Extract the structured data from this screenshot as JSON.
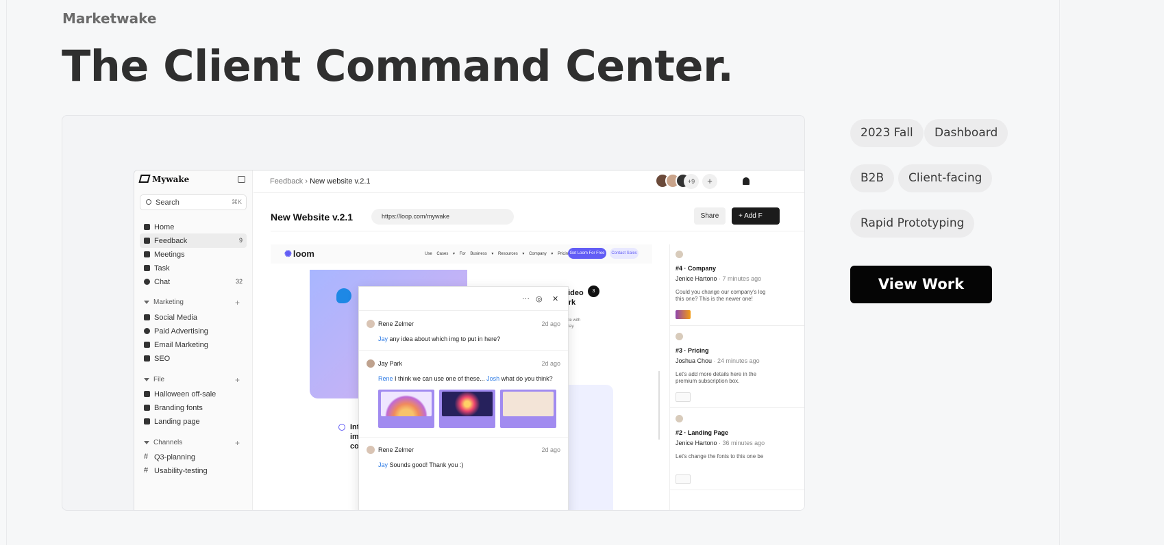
{
  "header": {
    "company": "Marketwake",
    "title": "The Client Command Center."
  },
  "tags": [
    "2023 Fall",
    "Dashboard",
    "B2B",
    "Client-facing",
    "Rapid Prototyping"
  ],
  "cta": {
    "label": "View Work"
  },
  "mockup": {
    "brand": "Mywake",
    "search_placeholder": "Search",
    "search_shortcut": "⌘K",
    "nav": [
      {
        "label": "Home",
        "count": ""
      },
      {
        "label": "Feedback",
        "count": "9"
      },
      {
        "label": "Meetings",
        "count": ""
      },
      {
        "label": "Task",
        "count": ""
      },
      {
        "label": "Chat",
        "count": "32"
      }
    ],
    "sections": {
      "marketing": {
        "label": "Marketing",
        "items": [
          "Social Media",
          "Paid Advertising",
          "Email Marketing",
          "SEO"
        ]
      },
      "file": {
        "label": "File",
        "items": [
          "Halloween off-sale",
          "Branding fonts",
          "Landing page"
        ]
      },
      "channels": {
        "label": "Channels",
        "items": [
          "Q3-planning",
          "Usability-testing"
        ]
      }
    },
    "breadcrumb": {
      "parent": "Feedback",
      "current": "New website v.2.1"
    },
    "avatar_more": "+9",
    "doc_title": "New Website v.2.1",
    "url": "https://loop.com/mywake",
    "share_label": "Share",
    "add_label": "Add F",
    "loom": {
      "logo": "loom",
      "nav": "Use Cases ▾  For Business ▾  Resources ▾  Company ▾  Pricing  Sign In",
      "btn_primary": "Get Loom For Free",
      "btn_secondary": "Contact Sales",
      "video_title_1": "video",
      "video_title_2": "ork",
      "video_sub": "ck,\nnate with\ny day.",
      "badge": "3",
      "intro_1": "Int",
      "intro_2": "im",
      "intro_3": "co"
    },
    "thread": {
      "messages": [
        {
          "author": "Rene Zelmer",
          "ago": "2d ago",
          "mention": "Jay",
          "text": " any idea about which img to put in here?"
        },
        {
          "author": "Jay Park",
          "ago": "2d ago",
          "mention": "Rene",
          "text": " I think we can use one of these... ",
          "mention2": "Josh",
          "text2": " what do you think?"
        },
        {
          "author": "Rene Zelmer",
          "ago": "2d ago",
          "mention": "Jay",
          "text": " Sounds good! Thank you :)"
        }
      ]
    },
    "feedback": [
      {
        "heading": "#4 · Company",
        "author": "Jenice Hartono",
        "time": " · 7 minutes ago",
        "message": "Could you change our company's log\nthis one? This is the newer one!"
      },
      {
        "heading": "#3 · Pricing",
        "author": "Joshua Chou",
        "time": " · 24 minutes ago",
        "message": "Let's add more details here in the\npremium subscription box."
      },
      {
        "heading": "#2 · Landing Page",
        "author": "Jenice Hartono",
        "time": " · 36 minutes ago",
        "message": "Let's change the fonts to this one be"
      }
    ]
  }
}
